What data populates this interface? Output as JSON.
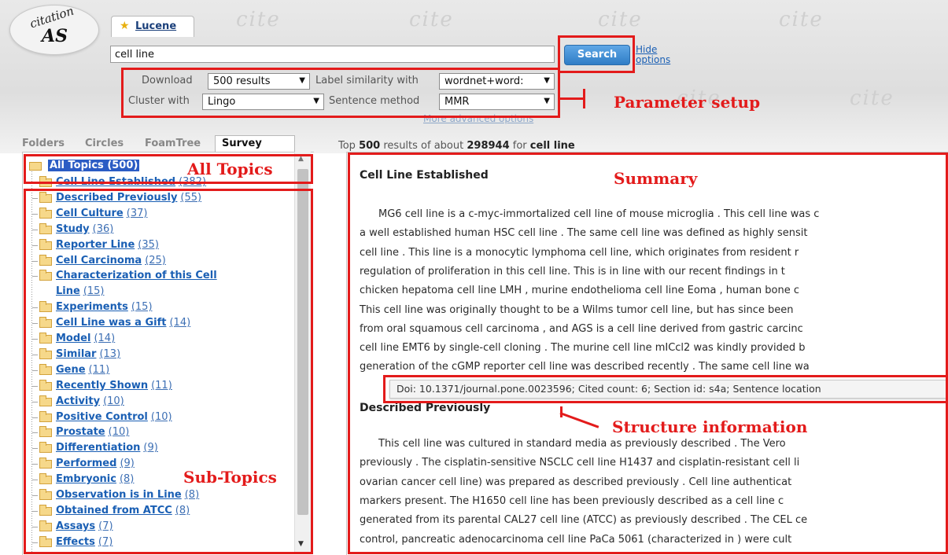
{
  "logo": {
    "top": "citation",
    "main": "AS"
  },
  "tab": {
    "label": "Lucene"
  },
  "search": {
    "query": "cell line",
    "button": "Search",
    "hide_options": "Hide options"
  },
  "params": {
    "download_label": "Download",
    "download_value": "500 results",
    "label_similarity_label": "Label similarity with",
    "label_similarity_value": "wordnet+word:",
    "cluster_label": "Cluster with",
    "cluster_value": "Lingo",
    "sentence_label": "Sentence method",
    "sentence_value": "MMR",
    "more": "More advanced options"
  },
  "view_tabs": [
    "Folders",
    "Circles",
    "FoamTree",
    "Survey"
  ],
  "tree": {
    "root": {
      "name": "All Topics",
      "count": "(500)"
    },
    "items": [
      {
        "name": "Cell Line Established",
        "count": "(382)"
      },
      {
        "name": "Described Previously",
        "count": "(55)"
      },
      {
        "name": "Cell Culture",
        "count": "(37)"
      },
      {
        "name": "Study",
        "count": "(36)"
      },
      {
        "name": "Reporter Line",
        "count": "(35)"
      },
      {
        "name": "Cell Carcinoma",
        "count": "(25)"
      },
      {
        "name": "Characterization of this Cell",
        "count": ""
      },
      {
        "name": "Line",
        "count": "(15)"
      },
      {
        "name": "Experiments",
        "count": "(15)"
      },
      {
        "name": "Cell Line was a Gift",
        "count": "(14)"
      },
      {
        "name": "Model",
        "count": "(14)"
      },
      {
        "name": "Similar",
        "count": "(13)"
      },
      {
        "name": "Gene",
        "count": "(11)"
      },
      {
        "name": "Recently Shown",
        "count": "(11)"
      },
      {
        "name": "Activity",
        "count": "(10)"
      },
      {
        "name": "Positive Control",
        "count": "(10)"
      },
      {
        "name": "Prostate",
        "count": "(10)"
      },
      {
        "name": "Differentiation",
        "count": "(9)"
      },
      {
        "name": "Performed",
        "count": "(9)"
      },
      {
        "name": "Embryonic",
        "count": "(8)"
      },
      {
        "name": "Observation is in Line",
        "count": "(8)"
      },
      {
        "name": "Obtained from ATCC",
        "count": "(8)"
      },
      {
        "name": "Assays",
        "count": "(7)"
      },
      {
        "name": "Effects",
        "count": "(7)"
      }
    ]
  },
  "results": {
    "pre": "Top",
    "top": "500",
    "mid": "results of about",
    "total": "298944",
    "for": "for",
    "query": "cell line"
  },
  "summary": {
    "section1_title": "Cell Line Established",
    "section1_lines": [
      "MG6 cell line is a c-myc-immortalized cell line of mouse microglia . This cell line was c",
      "a well established human HSC cell line . The same cell line was defined as highly sensit",
      "cell line . This line is a monocytic lymphoma cell line, which originates from resident r",
      "regulation of proliferation in this cell line. This is in line with our recent findings in t",
      "chicken hepatoma cell line LMH , murine endothelioma cell line Eoma , human bone c",
      "This cell line was originally thought to be a Wilms tumor cell line, but has since been",
      "from oral squamous cell carcinoma , and AGS is a cell line derived from gastric carcinc",
      "cell line EMT6 by single-cell cloning . The murine cell line mICcl2 was kindly provided b",
      "generation of the cGMP reporter cell line was described recently . The same cell line wa"
    ],
    "tooltip": "Doi: 10.1371/journal.pone.0023596;  Cited count: 6;  Section id: s4a;  Sentence location",
    "section2_title": "Described Previously",
    "section2_lines": [
      "This cell line was cultured in standard media as previously described . The Vero",
      "previously . The cisplatin-sensitive NSCLC cell line H1437 and cisplatin-resistant cell li",
      "ovarian cancer cell line) was prepared as described previously . Cell line authenticat",
      "markers present. The H1650 cell line has been previously described as a cell line c",
      "generated from its parental CAL27 cell line (ATCC) as previously described . The CEL ce",
      "control, pancreatic adenocarcinoma cell line PaCa 5061 (characterized in ) were cult"
    ]
  },
  "annotations": {
    "parameter_setup": "Parameter setup",
    "all_topics": "All Topics",
    "summary": "Summary",
    "structure_information": "Structure information",
    "sub_topics": "Sub-Topics"
  },
  "colors": {
    "annotation": "#e31b1b",
    "link": "#1a5fb4",
    "selected": "#2b5cc4",
    "button": "#2f7dc6"
  }
}
